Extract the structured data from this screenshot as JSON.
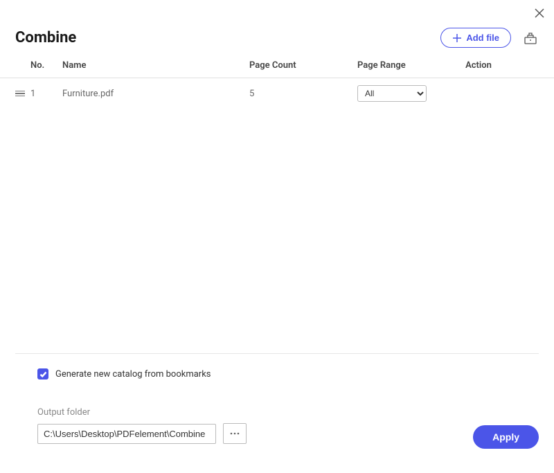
{
  "header": {
    "title": "Combine",
    "add_file_label": "Add file"
  },
  "table": {
    "columns": {
      "no": "No.",
      "name": "Name",
      "page_count": "Page Count",
      "page_range": "Page Range",
      "action": "Action"
    },
    "rows": [
      {
        "no": "1",
        "name": "Furniture.pdf",
        "page_count": "5",
        "page_range": "All"
      }
    ]
  },
  "footer": {
    "catalog_label": "Generate new catalog from bookmarks",
    "catalog_checked": true,
    "output_folder_label": "Output folder",
    "output_folder_value": "C:\\Users\\Desktop\\PDFelement\\Combine",
    "apply_label": "Apply"
  }
}
